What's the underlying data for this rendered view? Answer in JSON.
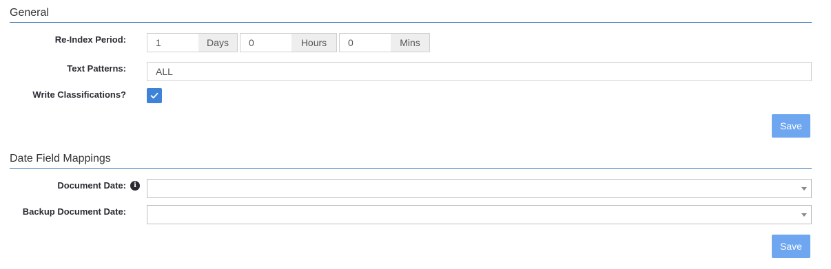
{
  "general": {
    "title": "General",
    "reindex": {
      "label": "Re-Index Period:",
      "days_value": "1",
      "days_addon": "Days",
      "hours_value": "0",
      "hours_addon": "Hours",
      "mins_value": "0",
      "mins_addon": "Mins"
    },
    "text_patterns": {
      "label": "Text Patterns:",
      "value": "ALL"
    },
    "write_classifications": {
      "label": "Write Classifications?",
      "checked": true
    },
    "save_label": "Save"
  },
  "date_mappings": {
    "title": "Date Field Mappings",
    "document_date": {
      "label": "Document Date:",
      "value": ""
    },
    "backup_document_date": {
      "label": "Backup Document Date:",
      "value": ""
    },
    "save_label": "Save"
  },
  "icons": {
    "info": "info-icon",
    "check": "check-icon",
    "caret": "chevron-down-icon"
  },
  "colors": {
    "accent": "#3f83d9",
    "button": "#6ea6f0",
    "rule": "#3b78b8"
  }
}
